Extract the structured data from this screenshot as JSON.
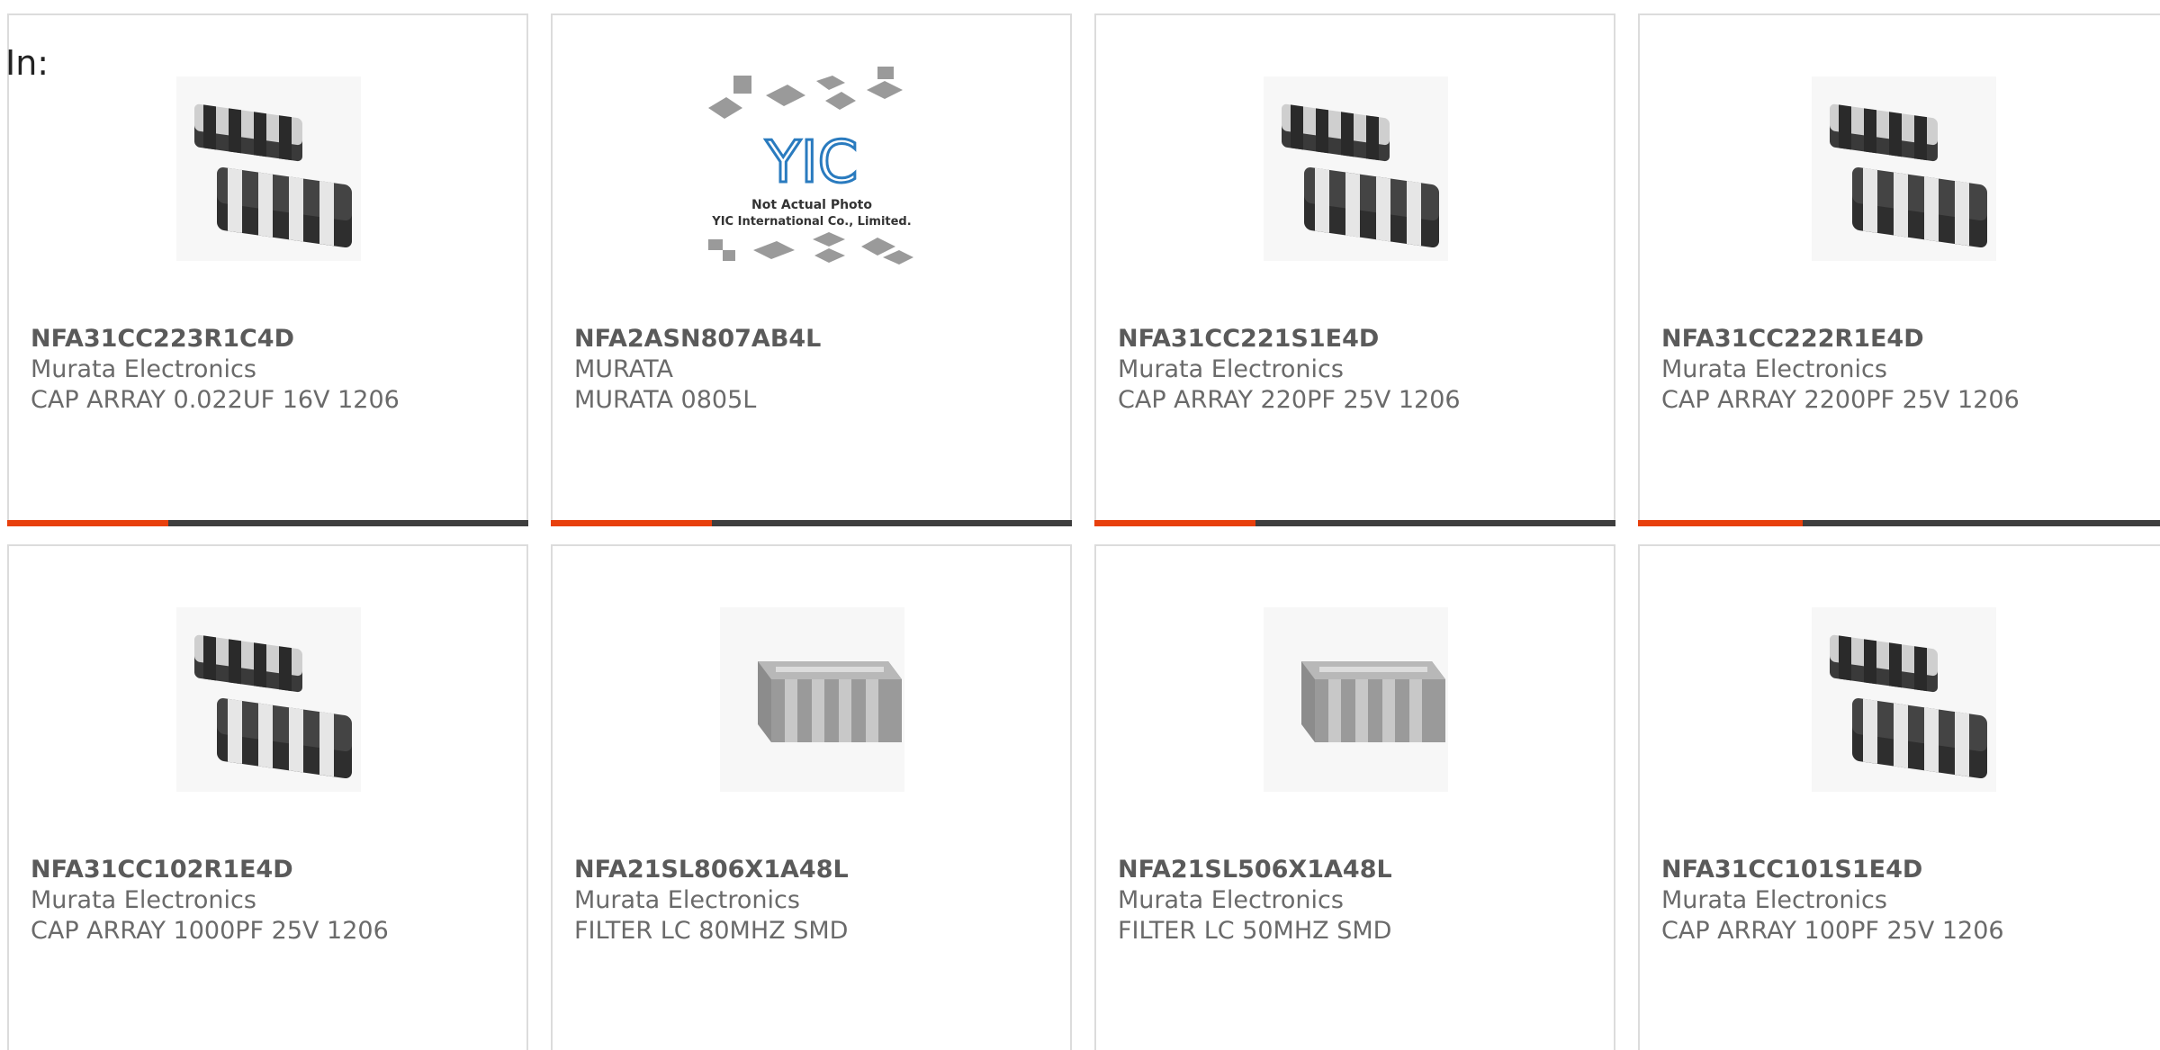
{
  "header": {
    "in_label": "In:"
  },
  "colors": {
    "accent": "#e8400c",
    "track": "#3e3e3e",
    "card_border": "#dcdcdc"
  },
  "products": [
    {
      "part_no": "NFA31CC223R1C4D",
      "manufacturer": "Murata Electronics",
      "description": "CAP ARRAY 0.022UF 16V 1206",
      "image": "chip-array-dark-icon",
      "progress": 0.31
    },
    {
      "part_no": "NFA2ASN807AB4L",
      "manufacturer": "MURATA",
      "description": "MURATA 0805L",
      "image": "not-actual-photo-placeholder",
      "placeholder_lines": [
        "Not Actual Photo",
        "YIC International Co., Limited."
      ],
      "placeholder_logo": "YIC",
      "progress": 0.31
    },
    {
      "part_no": "NFA31CC221S1E4D",
      "manufacturer": "Murata Electronics",
      "description": "CAP ARRAY 220PF 25V 1206",
      "image": "chip-array-dark-icon",
      "progress": 0.31
    },
    {
      "part_no": "NFA31CC222R1E4D",
      "manufacturer": "Murata Electronics",
      "description": "CAP ARRAY 2200PF 25V 1206",
      "image": "chip-array-dark-icon",
      "progress": 0.31
    },
    {
      "part_no": "NFA31CC102R1E4D",
      "manufacturer": "Murata Electronics",
      "description": "CAP ARRAY 1000PF 25V 1206",
      "image": "chip-array-dark-icon"
    },
    {
      "part_no": "NFA21SL806X1A48L",
      "manufacturer": "Murata Electronics",
      "description": "FILTER LC 80MHZ SMD",
      "image": "chip-filter-gray-icon"
    },
    {
      "part_no": "NFA21SL506X1A48L",
      "manufacturer": "Murata Electronics",
      "description": "FILTER LC 50MHZ SMD",
      "image": "chip-filter-gray-icon"
    },
    {
      "part_no": "NFA31CC101S1E4D",
      "manufacturer": "Murata Electronics",
      "description": "CAP ARRAY 100PF 25V 1206",
      "image": "chip-array-dark-icon"
    }
  ]
}
